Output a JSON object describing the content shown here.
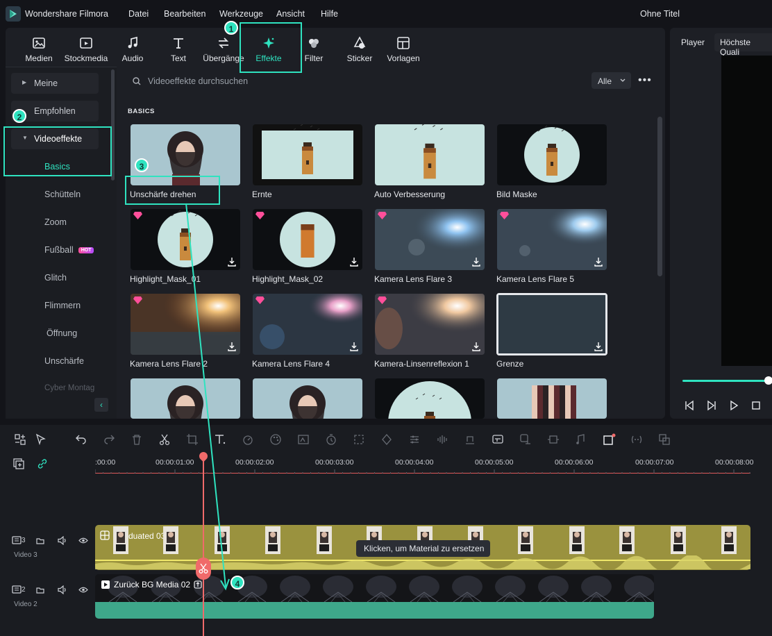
{
  "app": {
    "name": "Wondershare Filmora",
    "title": "Ohne Titel"
  },
  "menu": [
    "Datei",
    "Bearbeiten",
    "Werkzeuge",
    "Ansicht",
    "Hilfe"
  ],
  "toolbar": [
    {
      "label": "Medien",
      "icon": "media-icon"
    },
    {
      "label": "Stockmedia",
      "icon": "stockmedia-icon"
    },
    {
      "label": "Audio",
      "icon": "audio-icon"
    },
    {
      "label": "Text",
      "icon": "text-icon"
    },
    {
      "label": "Übergänge",
      "icon": "transition-icon"
    },
    {
      "label": "Effekte",
      "icon": "effects-icon",
      "active": true
    },
    {
      "label": "Filter",
      "icon": "filter-icon"
    },
    {
      "label": "Sticker",
      "icon": "sticker-icon"
    },
    {
      "label": "Vorlagen",
      "icon": "templates-icon"
    }
  ],
  "sidebar": {
    "nodes": [
      "Meine",
      "Empfohlen",
      "Videoeffekte"
    ],
    "items": [
      {
        "label": "Basics",
        "active": true
      },
      {
        "label": "Schütteln"
      },
      {
        "label": "Zoom"
      },
      {
        "label": "Fußball",
        "badge": "HOT"
      },
      {
        "label": "Glitch"
      },
      {
        "label": "Flimmern"
      },
      {
        "label": "Öffnung"
      },
      {
        "label": "Unschärfe"
      },
      {
        "label": "Cyber Montag"
      }
    ]
  },
  "search": {
    "placeholder": "Videoeffekte durchsuchen",
    "filter": "Alle"
  },
  "section": "BASICS",
  "effects": [
    {
      "label": "Unschärfe drehen",
      "thumb": "portrait",
      "premium": false,
      "download": false
    },
    {
      "label": "Ernte",
      "thumb": "tower-crop",
      "premium": false,
      "download": false
    },
    {
      "label": "Auto Verbesserung",
      "thumb": "tower",
      "premium": false,
      "download": false
    },
    {
      "label": "Bild Maske",
      "thumb": "tower-circle",
      "premium": false,
      "download": false
    },
    {
      "label": "Highlight_Mask_01",
      "thumb": "tower-circle",
      "premium": true,
      "download": true
    },
    {
      "label": "Highlight_Mask_02",
      "thumb": "tower-circle2",
      "premium": true,
      "download": true
    },
    {
      "label": "Kamera Lens Flare 3",
      "thumb": "flare-blue",
      "premium": true,
      "download": true
    },
    {
      "label": "Kamera Lens Flare 5",
      "thumb": "flare-blue2",
      "premium": true,
      "download": true
    },
    {
      "label": "Kamera Lens Flare 2",
      "thumb": "flare-orange",
      "premium": true,
      "download": true
    },
    {
      "label": "Kamera Lens Flare 4",
      "thumb": "flare-pink",
      "premium": true,
      "download": true
    },
    {
      "label": "Kamera-Linsenreflexion 1",
      "thumb": "flare-warm",
      "premium": true,
      "download": true
    },
    {
      "label": "Grenze",
      "thumb": "border",
      "premium": false,
      "download": true
    },
    {
      "label": "",
      "thumb": "portrait",
      "premium": false,
      "download": false
    },
    {
      "label": "",
      "thumb": "portrait",
      "premium": false,
      "download": false
    },
    {
      "label": "",
      "thumb": "tower-arch",
      "premium": false,
      "download": false
    },
    {
      "label": "",
      "thumb": "pixel",
      "premium": false,
      "download": false
    }
  ],
  "player": {
    "tab": "Player",
    "quality": "Höchste Quali"
  },
  "timeline": {
    "ticks": [
      ":00:00",
      "00:00:01:00",
      "00:00:02:00",
      "00:00:03:00",
      "00:00:04:00",
      "00:00:05:00",
      "00:00:06:00",
      "00:00:07:00",
      "00:00:08:00"
    ],
    "tracks": [
      {
        "num": "3",
        "name": "Video 3",
        "clip": "Graduated 03"
      },
      {
        "num": "2",
        "name": "Video 2",
        "clip": "Zurück BG Media 02"
      }
    ],
    "tooltip": "Klicken, um Material zu ersetzen"
  },
  "annotations": [
    "1",
    "2",
    "3",
    "4"
  ],
  "colors": {
    "accent": "#2fe3c0",
    "playhead": "#f06a6a",
    "clip3": "#9a923e",
    "clip2": "#3ea78a"
  }
}
